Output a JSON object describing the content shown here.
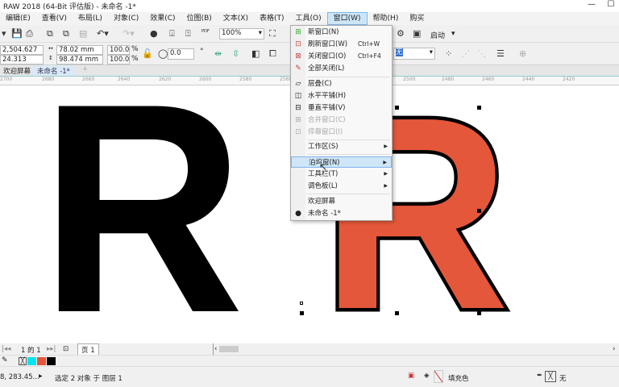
{
  "title": "RAW 2018 (64-Bit 评估版) - 未命名 -1*",
  "menubar": [
    "编辑(E)",
    "查看(V)",
    "布局(L)",
    "对象(C)",
    "效果(C)",
    "位图(B)",
    "文本(X)",
    "表格(T)",
    "工具(O)",
    "窗口(W)",
    "帮助(H)",
    "购买"
  ],
  "toolbar": {
    "zoom": "100%",
    "launch": "启动",
    "pdf": "PDF"
  },
  "props": {
    "x": "2,504.627 mm",
    "y": "24.313 mm",
    "w": "78.02 mm",
    "h": "98.474 mm",
    "sx": "100.0",
    "sy": "100.0",
    "pct": "%",
    "rotation": "0.0",
    "deg": "°",
    "outline": "无"
  },
  "tabs": [
    "欢迎屏幕",
    "未命名 -1*"
  ],
  "ruler": [
    "2700",
    "2680",
    "2660",
    "2640",
    "2620",
    "2600",
    "2580",
    "2560",
    "2500",
    "2480",
    "2460",
    "2440",
    "2420"
  ],
  "canvas": {
    "letter": "R",
    "fill_color": "#e4573a",
    "stroke_color": "#000000"
  },
  "window_menu": {
    "items": [
      {
        "label": "新窗口(N)",
        "icon": "new-window-icon",
        "glyph": "⊞"
      },
      {
        "label": "刷新窗口(W)",
        "shortcut": "Ctrl+W",
        "icon": "refresh-window-icon",
        "glyph": "⊡"
      },
      {
        "label": "关闭窗口(O)",
        "shortcut": "Ctrl+F4",
        "icon": "close-window-icon",
        "glyph": "⊠"
      },
      {
        "label": "全部关闭(L)",
        "icon": "close-all-icon",
        "glyph": "✎"
      },
      {
        "label": "层叠(C)",
        "icon": "cascade-icon",
        "glyph": "▱"
      },
      {
        "label": "水平平铺(H)",
        "icon": "tile-horizontal-icon",
        "glyph": "◫"
      },
      {
        "label": "垂直平铺(V)",
        "icon": "tile-vertical-icon",
        "glyph": "⊟"
      },
      {
        "label": "合并窗口(C)",
        "icon": "merge-window-icon",
        "glyph": "⊞"
      },
      {
        "label": "停靠窗口(I)",
        "icon": "dock-window-icon",
        "glyph": "⊡"
      },
      {
        "label": "工作区(S)"
      },
      {
        "label": "泊坞窗(N)"
      },
      {
        "label": "工具栏(T)"
      },
      {
        "label": "调色板(L)"
      },
      {
        "label": "欢迎屏幕"
      },
      {
        "label": "未命名 -1*"
      }
    ]
  },
  "pagebar": {
    "nav": "1 的 1",
    "page_tab": "页 1"
  },
  "palette": [
    "#00e5ee",
    "#e4573a",
    "#000000"
  ],
  "status": {
    "coords": "8, 283.45...",
    "message": "选定 2 对象 于 图层 1",
    "fill": "填充色",
    "outline": "无"
  }
}
